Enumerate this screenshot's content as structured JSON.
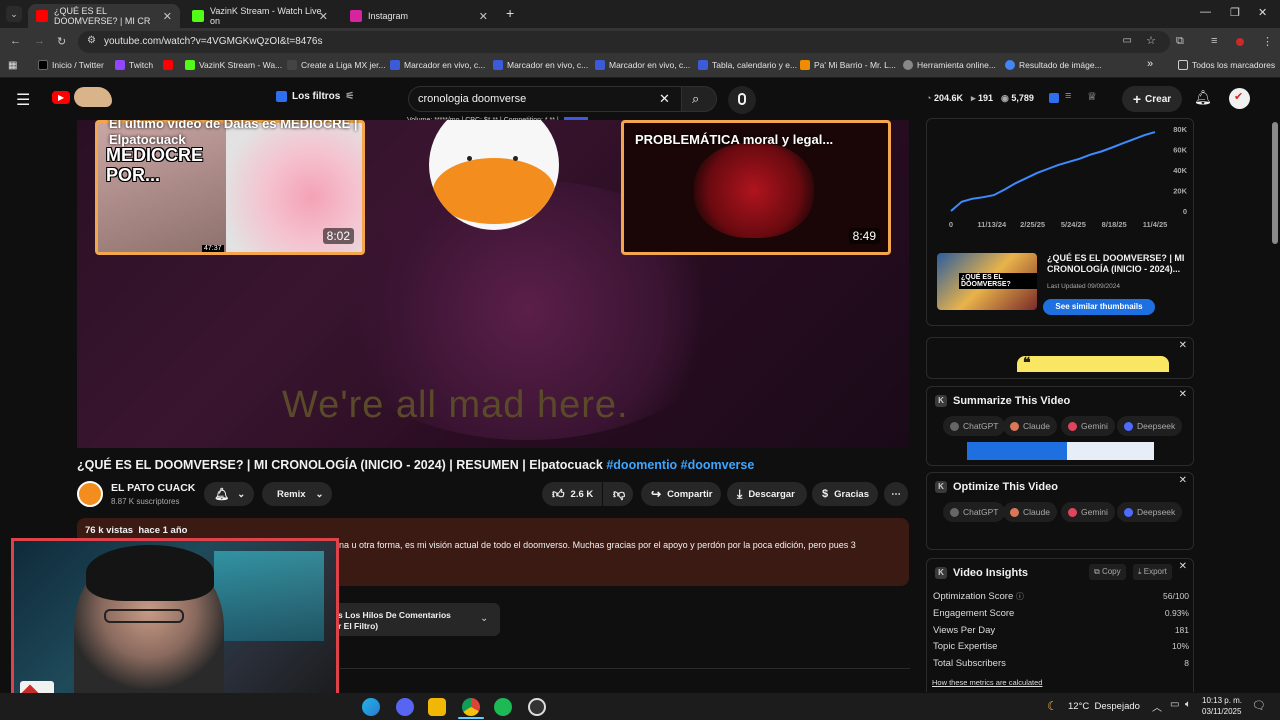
{
  "browser": {
    "tabs": [
      {
        "title": "¿QUÉ ES EL DOOMVERSE? | MI CR",
        "active": true,
        "color": "#ff0000"
      },
      {
        "title": "VazinK Stream - Watch Live on",
        "active": false,
        "color": "#53fc18"
      },
      {
        "title": "Instagram",
        "active": false,
        "color": "#d6249f"
      }
    ],
    "new_tab_glyph": "+",
    "url": "youtube.com/watch?v=4VGMGKwQzOI&t=8476s",
    "bookmarks": [
      {
        "label": "Inicio / Twitter",
        "color": "#000000"
      },
      {
        "label": "Twitch",
        "color": "#9146ff"
      },
      {
        "label": "",
        "color": "#ff0000"
      },
      {
        "label": "VazinK Stream - Wa...",
        "color": "#53fc18"
      },
      {
        "label": "Create a Liga MX jer...",
        "color": "#444444"
      },
      {
        "label": "Marcador en vivo, c...",
        "color": "#3b5bdb"
      },
      {
        "label": "Marcador en vivo, c...",
        "color": "#3b5bdb"
      },
      {
        "label": "Marcador en vivo, c...",
        "color": "#3b5bdb"
      },
      {
        "label": "Tabla, calendario y e...",
        "color": "#3b5bdb"
      },
      {
        "label": "Pa' Mi Barrio - Mr. L...",
        "color": "#f08c00"
      },
      {
        "label": "Herramienta online...",
        "color": "#888888"
      },
      {
        "label": "Resultado de imáge...",
        "color": "#4285f4"
      }
    ],
    "bookmarks_overflow": "»",
    "all_bookmarks": "Todos los marcadores"
  },
  "youtube": {
    "filters_label": "Los filtros",
    "search_value": "cronologia doomverse",
    "search_meta": "Volume: *****/mo | CPC: $*.** | Competition: *.** |",
    "stats": {
      "views": "204.6K",
      "videos": "191",
      "subs": "5,789"
    },
    "create_label": "Crear"
  },
  "player": {
    "thumb1_title": "El último video de Dalas es MEDIOCRE | Elpatocuack",
    "thumb1_art": "MEDIOCRE POR...",
    "thumb1_small_duration": "47:37",
    "thumb1_duration": "8:02",
    "thumb3_title": "PROBLEMÁTICA moral y legal...",
    "thumb3_duration": "8:49",
    "caption": "We're all mad here."
  },
  "video": {
    "title": "¿QUÉ ES EL DOOMVERSE? | MI CRONOLOGÍA (INICIO - 2024) | RESUMEN | Elpatocuack",
    "tag1": "#doomentio",
    "tag2": "#doomverse",
    "channel": "EL PATO CUACK",
    "subscribers": "8.87 K suscriptores",
    "remix": "Remix",
    "likes": "2.6 K",
    "share": "Compartir",
    "download": "Descargar",
    "thanks": "Gracias",
    "views_ago": "76 k vistas  hace 1 año",
    "description": "na u otra forma, es mi visión actual de todo el doomverso. Muchas gracias por  el apoyo y perdón por la poca edición, pero pues 3",
    "comments_filter_1": "s Los Hilos De Comentarios",
    "comments_filter_2": "r El Filtro)"
  },
  "sidebar": {
    "chart_data": {
      "type": "line",
      "x_ticks": [
        "0",
        "11/13/24",
        "2/25/25",
        "5/24/25",
        "8/18/25",
        "11/4/25"
      ],
      "y_ticks": [
        "80K",
        "60K",
        "40K",
        "20K",
        "0"
      ],
      "ylim": [
        0,
        80000
      ],
      "series": [
        {
          "values": [
            0,
            9000,
            12000,
            13500,
            15500,
            21000,
            27000,
            32000,
            37000,
            41000,
            45000,
            48000,
            51000,
            55000,
            58000,
            62000,
            66000,
            70000,
            74000,
            77000
          ]
        }
      ]
    },
    "thumb_title": "¿QUÉ ES EL DOOMVERSE? | MI CRONOLOGÍA (INICIO - 2024)...",
    "last_updated": "Last Updated 09/09/2024",
    "similar_btn": "See similar thumbnails",
    "summarize_title": "Summarize This Video",
    "optimize_title": "Optimize This Video",
    "ai_tools": [
      {
        "name": "ChatGPT",
        "color": "#666666"
      },
      {
        "name": "Claude",
        "color": "#d97757"
      },
      {
        "name": "Gemini",
        "color": "#e2445c"
      },
      {
        "name": "Deepseek",
        "color": "#4d6bfe"
      }
    ],
    "insights_title": "Video Insights",
    "copy_label": "Copy",
    "export_label": "Export",
    "metrics": [
      {
        "label": "Optimization Score",
        "value": "56/100"
      },
      {
        "label": "Engagement Score",
        "value": "0.93%"
      },
      {
        "label": "Views Per Day",
        "value": "181"
      },
      {
        "label": "Topic Expertise",
        "value": "10%"
      },
      {
        "label": "Total Subscribers",
        "value": "8"
      }
    ],
    "how_link": "How these metrics are calculated"
  },
  "taskbar": {
    "weather": "12°C  Despejado",
    "time": "10:13 p. m.",
    "date": "03/11/2025"
  }
}
